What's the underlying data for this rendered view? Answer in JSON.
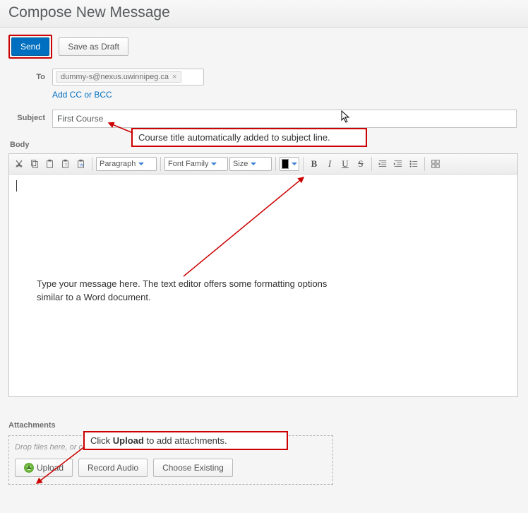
{
  "header": {
    "title": "Compose New Message"
  },
  "actions": {
    "send": "Send",
    "save_draft": "Save as Draft"
  },
  "to": {
    "label": "To",
    "recipient": "dummy-s@nexus.uwinnipeg.ca",
    "cc_link": "Add CC or BCC"
  },
  "subject": {
    "label": "Subject",
    "value": "First Course"
  },
  "body_label": "Body",
  "toolbar": {
    "paragraph": "Paragraph",
    "font_family": "Font Family",
    "size": "Size",
    "bold": "B",
    "italic": "I",
    "underline": "U",
    "strike": "S"
  },
  "annotations": {
    "subject_note": "Course title automatically added to subject line.",
    "body_note": "Type your message here. The text editor offers some formatting options similar to a Word document.",
    "upload_note_pre": "Click ",
    "upload_note_bold": "Upload",
    "upload_note_post": "  to add attachments."
  },
  "attachments": {
    "label": "Attachments",
    "drop_hint": "Drop files here, or click below!",
    "upload": "Upload",
    "record": "Record Audio",
    "choose": "Choose Existing"
  }
}
